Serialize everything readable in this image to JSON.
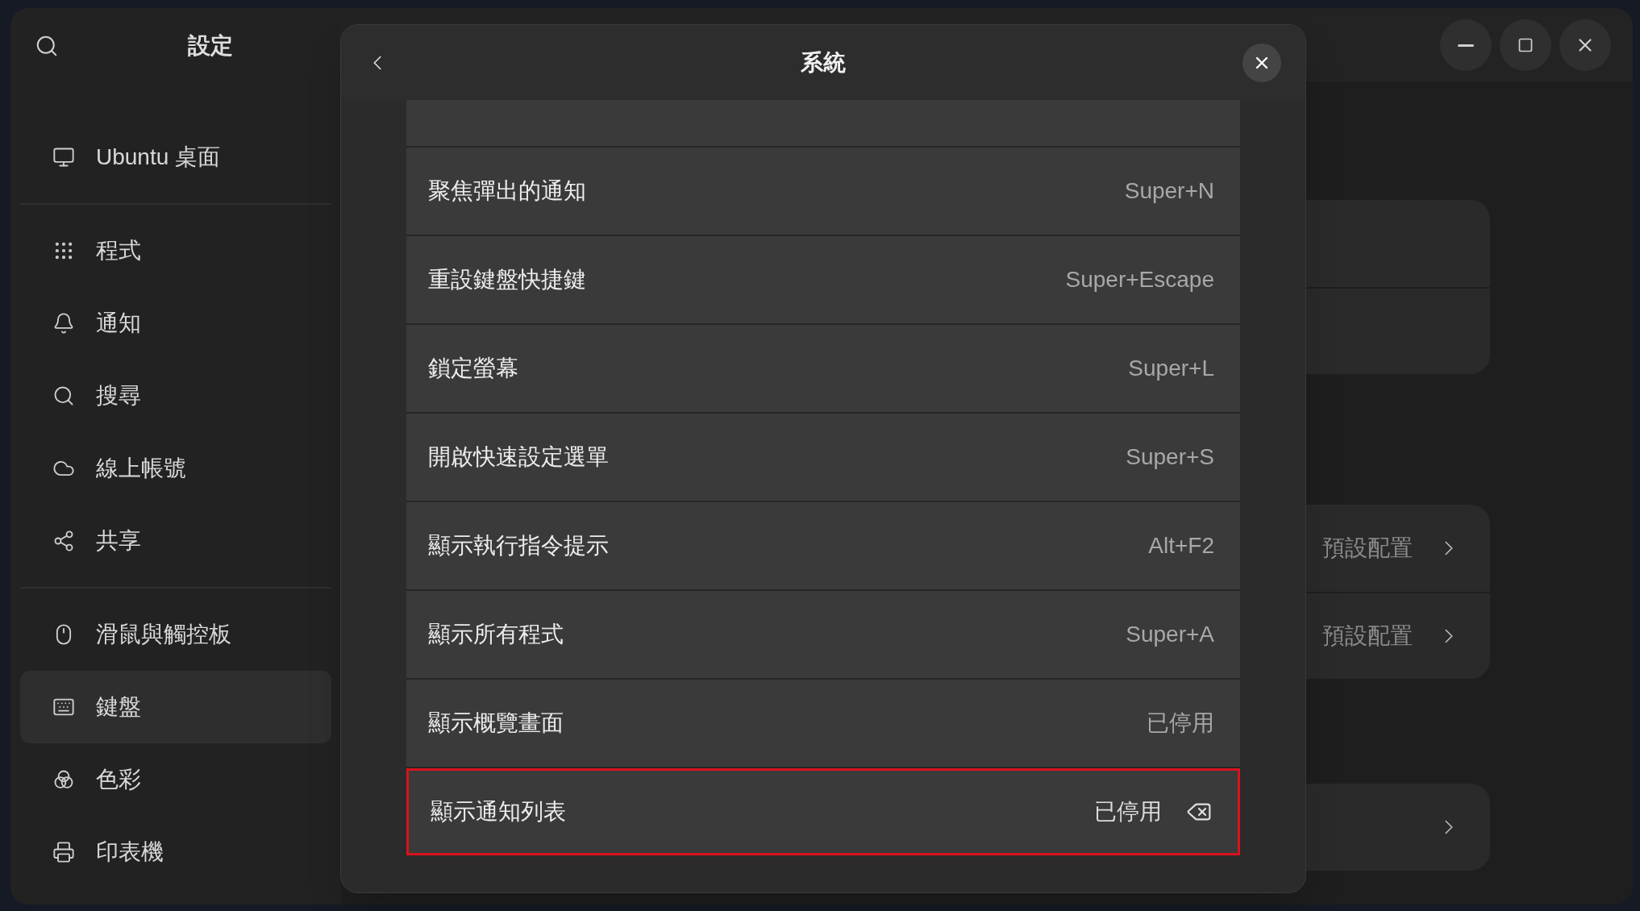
{
  "sidebar": {
    "title": "設定",
    "groups": [
      {
        "items": [
          {
            "label": "Ubuntu 桌面",
            "selected": false
          }
        ]
      },
      {
        "items": [
          {
            "label": "程式",
            "selected": false
          },
          {
            "label": "通知",
            "selected": false
          },
          {
            "label": "搜尋",
            "selected": false
          },
          {
            "label": "線上帳號",
            "selected": false
          },
          {
            "label": "共享",
            "selected": false
          }
        ]
      },
      {
        "items": [
          {
            "label": "滑鼠與觸控板",
            "selected": false
          },
          {
            "label": "鍵盤",
            "selected": true
          },
          {
            "label": "色彩",
            "selected": false
          },
          {
            "label": "印表機",
            "selected": false
          }
        ]
      }
    ]
  },
  "panels": [
    {
      "rows": [
        {
          "chevron": false
        },
        {
          "chevron": false
        }
      ]
    },
    {
      "rows": [
        {
          "value": "預設配置",
          "chevron": true
        },
        {
          "value": "預設配置",
          "chevron": true
        }
      ]
    },
    {
      "rows": [
        {
          "chevron": true
        }
      ]
    }
  ],
  "dialog": {
    "title": "系統",
    "rows": [
      {
        "label": "聚焦彈出的通知",
        "shortcut": "Super+N",
        "selected": false
      },
      {
        "label": "重設鍵盤快捷鍵",
        "shortcut": "Super+Escape",
        "selected": false
      },
      {
        "label": "鎖定螢幕",
        "shortcut": "Super+L",
        "selected": false
      },
      {
        "label": "開啟快速設定選單",
        "shortcut": "Super+S",
        "selected": false
      },
      {
        "label": "顯示執行指令提示",
        "shortcut": "Alt+F2",
        "selected": false
      },
      {
        "label": "顯示所有程式",
        "shortcut": "Super+A",
        "selected": false
      },
      {
        "label": "顯示概覽畫面",
        "shortcut": "已停用",
        "selected": false
      },
      {
        "label": "顯示通知列表",
        "shortcut": "已停用",
        "selected": true
      }
    ]
  }
}
